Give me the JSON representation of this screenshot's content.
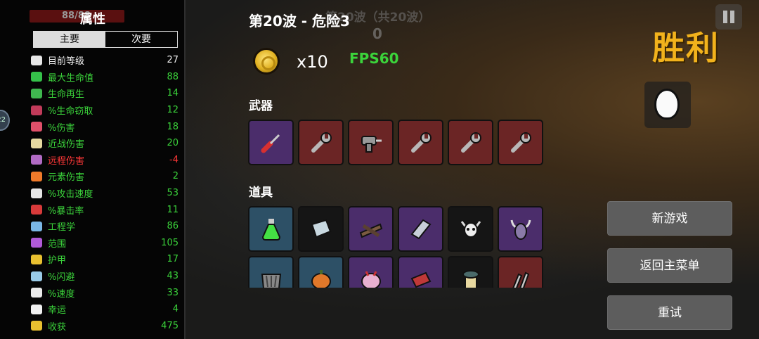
{
  "stats_panel": {
    "title": "属性",
    "hp_ghost": "88/88",
    "side_badge": "22",
    "tabs": [
      {
        "label": "主要",
        "active": true
      },
      {
        "label": "次要",
        "active": false
      }
    ],
    "rows": [
      {
        "label": "目前等级",
        "value": "27",
        "color": "white",
        "icon": "level-icon",
        "icon_color": "#e8e8e8"
      },
      {
        "label": "最大生命值",
        "value": "88",
        "color": "green",
        "icon": "heart-icon",
        "icon_color": "#35c14a"
      },
      {
        "label": "生命再生",
        "value": "14",
        "color": "green",
        "icon": "regen-icon",
        "icon_color": "#3fb84f"
      },
      {
        "label": "%生命窃取",
        "value": "12",
        "color": "green",
        "icon": "lifesteal-icon",
        "icon_color": "#c23b5a"
      },
      {
        "label": "%伤害",
        "value": "18",
        "color": "green",
        "icon": "damage-icon",
        "icon_color": "#e0506a"
      },
      {
        "label": "近战伤害",
        "value": "20",
        "color": "green",
        "icon": "sword-icon",
        "icon_color": "#e6d9a0"
      },
      {
        "label": "远程伤害",
        "value": "-4",
        "color": "red",
        "icon": "ranged-icon",
        "icon_color": "#b16bc4"
      },
      {
        "label": "元素伤害",
        "value": "2",
        "color": "green",
        "icon": "fire-icon",
        "icon_color": "#f07a2a"
      },
      {
        "label": "%攻击速度",
        "value": "53",
        "color": "green",
        "icon": "hourglass-icon",
        "icon_color": "#e6e6e6"
      },
      {
        "label": "%暴击率",
        "value": "11",
        "color": "green",
        "icon": "crit-icon",
        "icon_color": "#d83a3a"
      },
      {
        "label": "工程学",
        "value": "86",
        "color": "green",
        "icon": "wrench-cross-icon",
        "icon_color": "#7ab7e6"
      },
      {
        "label": "范围",
        "value": "105",
        "color": "green",
        "icon": "range-icon",
        "icon_color": "#b05ad8"
      },
      {
        "label": "护甲",
        "value": "17",
        "color": "green",
        "icon": "shield-icon",
        "icon_color": "#e8c030"
      },
      {
        "label": "%闪避",
        "value": "43",
        "color": "green",
        "icon": "dodge-icon",
        "icon_color": "#9acbe8"
      },
      {
        "label": "%速度",
        "value": "33",
        "color": "green",
        "icon": "speed-icon",
        "icon_color": "#eaeaea"
      },
      {
        "label": "幸运",
        "value": "4",
        "color": "green",
        "icon": "dice-icon",
        "icon_color": "#f0f0f0"
      },
      {
        "label": "收获",
        "value": "475",
        "color": "green",
        "icon": "harvest-icon",
        "icon_color": "#e8c030"
      }
    ]
  },
  "header": {
    "wave_title": "第20波 - 危险3",
    "ghost_wave_text": "第20波（共20波）",
    "ghost_zero": "0"
  },
  "currency": {
    "count": "x10",
    "fps": "FPS60"
  },
  "weapons": {
    "title": "武器",
    "items": [
      {
        "icon": "screwdriver-icon",
        "bg": "purple"
      },
      {
        "icon": "wrench-icon",
        "bg": "red"
      },
      {
        "icon": "drill-icon",
        "bg": "red"
      },
      {
        "icon": "wrench-icon",
        "bg": "red"
      },
      {
        "icon": "wrench-icon",
        "bg": "red"
      },
      {
        "icon": "wrench-icon",
        "bg": "red"
      }
    ]
  },
  "items": {
    "title": "道具",
    "row1": [
      {
        "icon": "potion-icon",
        "bg": "blue"
      },
      {
        "icon": "book-icon",
        "bg": "black"
      },
      {
        "icon": "planks-icon",
        "bg": "purple"
      },
      {
        "icon": "metal-plate-icon",
        "bg": "purple"
      },
      {
        "icon": "skull-icon",
        "bg": "black"
      },
      {
        "icon": "demon-head-icon",
        "bg": "purple"
      }
    ],
    "row2": [
      {
        "icon": "claw-icon",
        "bg": "blue"
      },
      {
        "icon": "pumpkin-icon",
        "bg": "blue"
      },
      {
        "icon": "brain-icon",
        "bg": "purple"
      },
      {
        "icon": "toolbox-icon",
        "bg": "purple"
      },
      {
        "icon": "jar-icon",
        "bg": "black"
      },
      {
        "icon": "rockets-icon",
        "bg": "red"
      }
    ]
  },
  "result": {
    "title": "胜利"
  },
  "buttons": {
    "new_game": "新游戏",
    "main_menu": "返回主菜单",
    "retry": "重试"
  },
  "colors": {
    "victory": "#f2b21c",
    "green_stat": "#3bd33b",
    "red_stat": "#ff3838",
    "button": "#5d5d5d"
  }
}
